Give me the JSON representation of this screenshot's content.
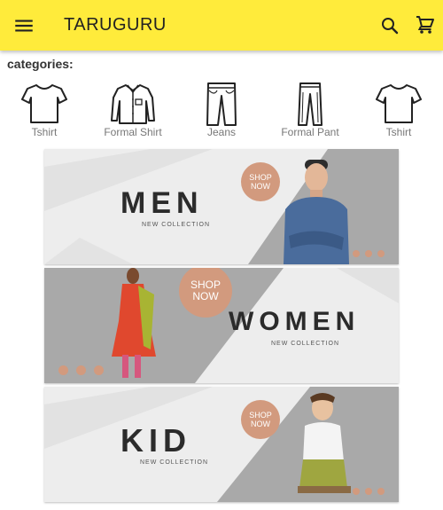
{
  "app": {
    "title": "TARUGURU"
  },
  "header": {
    "menu_icon": "menu-icon",
    "search_icon": "search-icon",
    "cart_icon": "cart-icon"
  },
  "categories": {
    "heading": "categories:",
    "items": [
      {
        "label": "Tshirt",
        "icon": "tshirt-icon"
      },
      {
        "label": "Formal Shirt",
        "icon": "formal-shirt-icon"
      },
      {
        "label": "Jeans",
        "icon": "jeans-icon"
      },
      {
        "label": "Formal Pant",
        "icon": "formal-pant-icon"
      },
      {
        "label": "Tshirt",
        "icon": "tshirt-icon"
      }
    ]
  },
  "banners": [
    {
      "title": "MEN",
      "subtitle": "NEW COLLECTION",
      "cta": "SHOP NOW"
    },
    {
      "title": "WOMEN",
      "subtitle": "NEW COLLECTION",
      "cta": "SHOP NOW"
    },
    {
      "title": "KID",
      "subtitle": "NEW COLLECTION",
      "cta": "SHOP NOW"
    }
  ],
  "colors": {
    "appbar": "#ffeb3b",
    "accent": "#d29a7e"
  }
}
